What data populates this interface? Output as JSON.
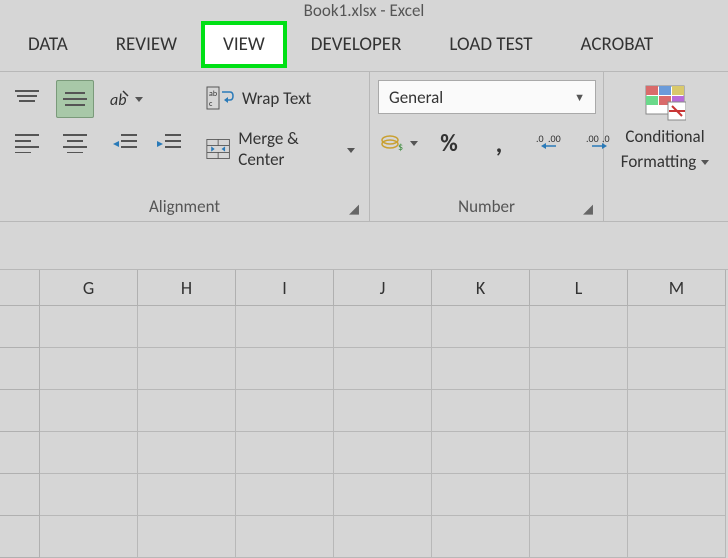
{
  "title": "Book1.xlsx - Excel",
  "tabs": {
    "data": "DATA",
    "review": "REVIEW",
    "view": "VIEW",
    "developer": "DEVELOPER",
    "loadtest": "LOAD TEST",
    "acrobat": "ACROBAT"
  },
  "ribbon": {
    "alignment": {
      "label": "Alignment",
      "wrap_text": "Wrap Text",
      "merge_center": "Merge & Center"
    },
    "number": {
      "label": "Number",
      "format": "General",
      "percent": "%",
      "comma": ","
    },
    "conditional": {
      "line1": "Conditional",
      "line2": "Formatting"
    }
  },
  "columns": [
    "G",
    "H",
    "I",
    "J",
    "K",
    "L",
    "M"
  ],
  "row_count": 6
}
